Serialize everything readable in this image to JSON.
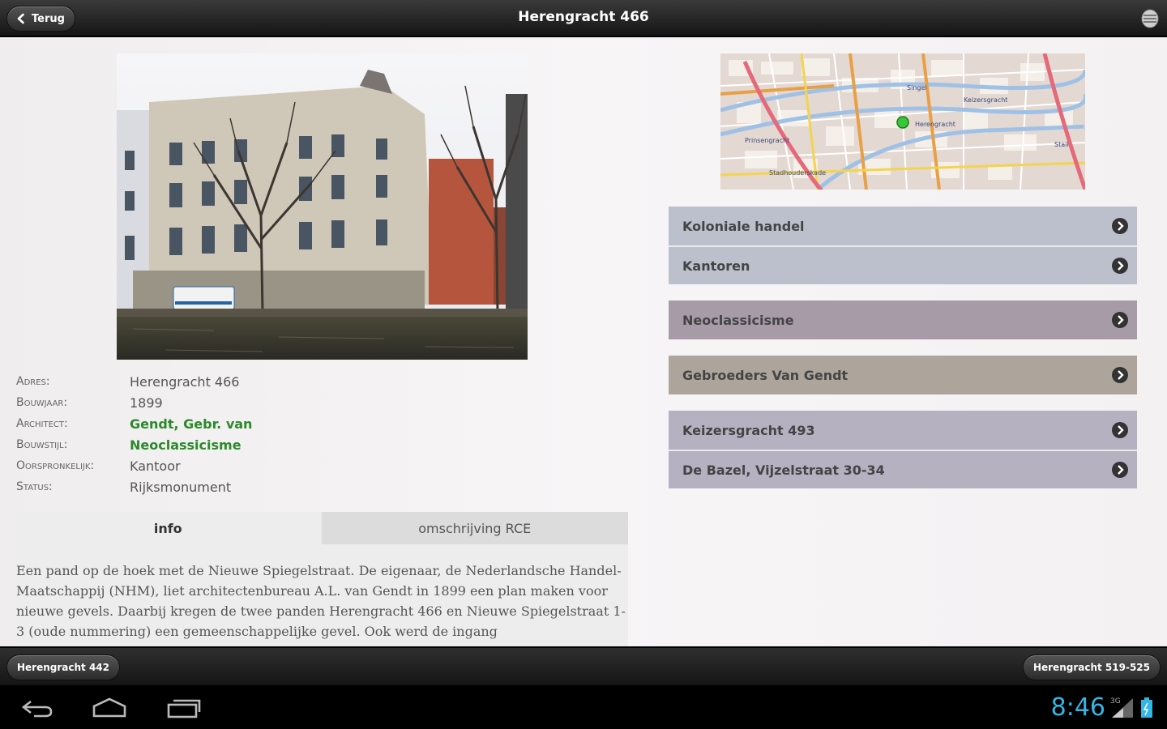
{
  "topbar": {
    "back_label": "Terug",
    "title": "Herengracht 466"
  },
  "details": [
    {
      "label": "Adres:",
      "value": "Herengracht 466",
      "is_link": false
    },
    {
      "label": "Bouwjaar:",
      "value": "1899",
      "is_link": false
    },
    {
      "label": "Architect:",
      "value": "Gendt, Gebr. van",
      "is_link": true
    },
    {
      "label": "Bouwstijl:",
      "value": "Neoclassicisme",
      "is_link": true
    },
    {
      "label": "Oorspronkelijk:",
      "value": "Kantoor",
      "is_link": false
    },
    {
      "label": "Status:",
      "value": "Rijksmonument",
      "is_link": false
    }
  ],
  "tabs": [
    {
      "label": "info",
      "active": true
    },
    {
      "label": "omschrijving RCE",
      "active": false
    }
  ],
  "description": "Een pand op de hoek met de Nieuwe Spiegelstraat. De eigenaar, de Nederlandsche Handel-Maatschappij (NHM), liet architectenbureau A.L. van Gendt in 1899 een plan maken voor nieuwe gevels. Daarbij kregen de twee panden Herengracht 466 en Nieuwe Spiegelstraat 1-3 (oude nummering) een gemeenschappelijke gevel. Ook werd de ingang",
  "map": {
    "labels": [
      "Singel",
      "Prinsengracht",
      "Keizersgracht",
      "Herengracht",
      "Stadhouderskade",
      "Stall"
    ]
  },
  "nav_groups": [
    {
      "items": [
        "Koloniale handel",
        "Kantoren"
      ]
    },
    {
      "items": [
        "Neoclassicisme"
      ]
    },
    {
      "items": [
        "Gebroeders Van Gendt"
      ]
    },
    {
      "items": [
        "Keizersgracht 493",
        "De Bazel, Vijzelstraat 30-34"
      ]
    }
  ],
  "bottombar": {
    "prev_label": "Herengracht 442",
    "next_label": "Herengracht 519-525"
  },
  "system": {
    "clock": "8:46",
    "signal_label": "3G"
  },
  "colors": {
    "accent_link": "#2a8a2a",
    "clock": "#33b5e5"
  }
}
